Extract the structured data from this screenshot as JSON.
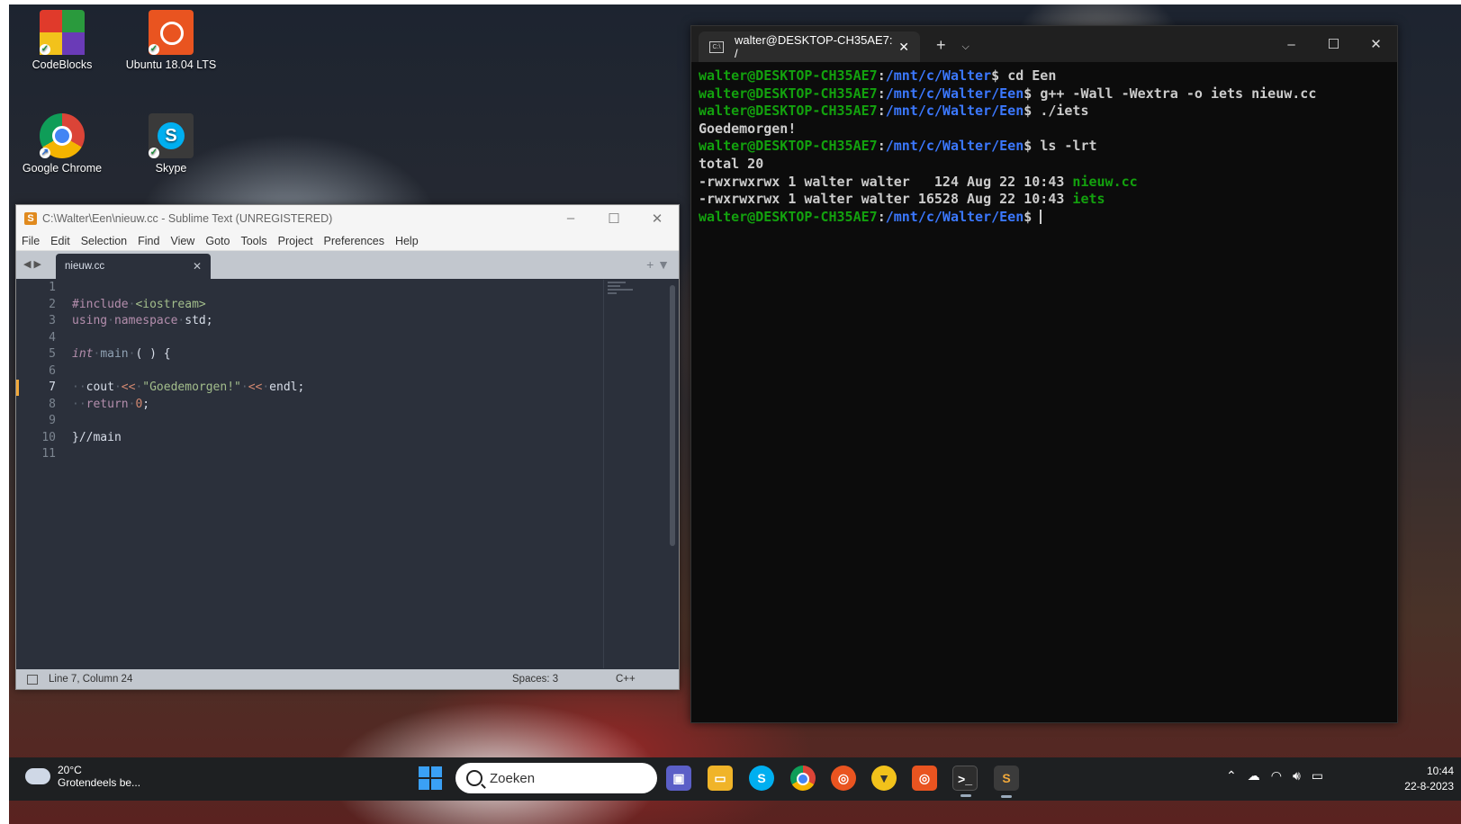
{
  "desktop": {
    "icons": [
      {
        "label": "CodeBlocks"
      },
      {
        "label": "Ubuntu 18.04 LTS"
      },
      {
        "label": "Google Chrome"
      },
      {
        "label": "Skype"
      }
    ]
  },
  "sublime": {
    "title": "C:\\Walter\\Een\\nieuw.cc - Sublime Text (UNREGISTERED)",
    "menu": [
      "File",
      "Edit",
      "Selection",
      "Find",
      "View",
      "Goto",
      "Tools",
      "Project",
      "Preferences",
      "Help"
    ],
    "tab_label": "nieuw.cc",
    "line_numbers": [
      "1",
      "2",
      "3",
      "4",
      "5",
      "6",
      "7",
      "8",
      "9",
      "10",
      "11"
    ],
    "active_line": 7,
    "code": {
      "l2_include": "#include",
      "l2_header": "<iostream>",
      "l3_using": "using",
      "l3_namespace": "namespace",
      "l3_std": "std;",
      "l5_int": "int",
      "l5_main": "main",
      "l5_rest": "( ) {",
      "l7_cout": "cout",
      "l7_op1": "<<",
      "l7_str": "\"Goedemorgen!\"",
      "l7_op2": "<<",
      "l7_endl": "endl;",
      "l8_return": "return",
      "l8_zero": "0",
      "l8_semi": ";",
      "l10": "}//main"
    },
    "status": {
      "position": "Line 7, Column 24",
      "spaces": "Spaces: 3",
      "syntax": "C++"
    }
  },
  "terminal": {
    "tab_title": "walter@DESKTOP-CH35AE7: /",
    "lines": [
      {
        "user": "walter@DESKTOP-CH35AE7",
        "path": "/mnt/c/Walter",
        "cmd": "cd Een"
      },
      {
        "user": "walter@DESKTOP-CH35AE7",
        "path": "/mnt/c/Walter/Een",
        "cmd": "g++ -Wall -Wextra -o iets nieuw.cc"
      },
      {
        "user": "walter@DESKTOP-CH35AE7",
        "path": "/mnt/c/Walter/Een",
        "cmd": "./iets"
      },
      {
        "output": "Goedemorgen!"
      },
      {
        "user": "walter@DESKTOP-CH35AE7",
        "path": "/mnt/c/Walter/Een",
        "cmd": "ls -lrt"
      },
      {
        "output": "total 20"
      },
      {
        "output": "-rwxrwxrwx 1 walter walter   124 Aug 22 10:43 ",
        "file": "nieuw.cc"
      },
      {
        "output": "-rwxrwxrwx 1 walter walter 16528 Aug 22 10:43 ",
        "file": "iets"
      },
      {
        "user": "walter@DESKTOP-CH35AE7",
        "path": "/mnt/c/Walter/Een",
        "cmd": ""
      }
    ]
  },
  "taskbar": {
    "weather_temp": "20°C",
    "weather_desc": "Grotendeels be...",
    "search_placeholder": "Zoeken",
    "time": "10:44",
    "date": "22-8-2023"
  },
  "colors": {
    "prompt_user": "#13a10e",
    "prompt_path": "#3b78ff",
    "sublime_bg": "#2b303b",
    "accent": "#f2a93b"
  }
}
